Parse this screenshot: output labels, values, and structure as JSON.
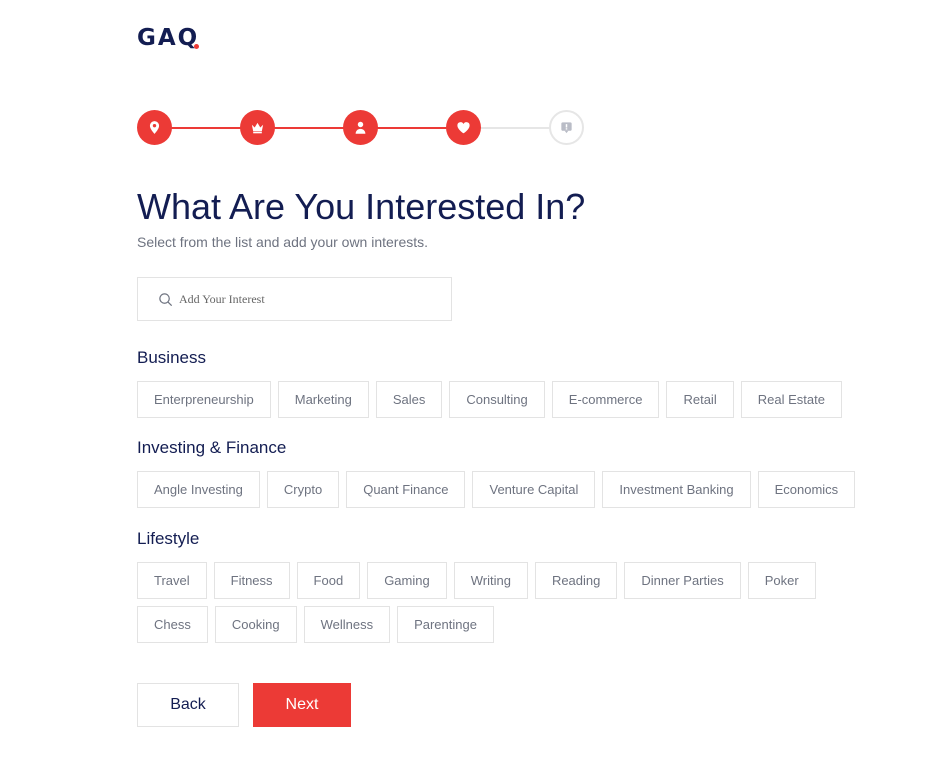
{
  "brand": {
    "logo_text": "GAQ"
  },
  "colors": {
    "accent": "#ec3a36",
    "navy": "#131d52",
    "muted": "#6e7380",
    "border": "#e3e3e3"
  },
  "stepper": {
    "steps": [
      {
        "icon": "location-pin-icon",
        "state": "done"
      },
      {
        "icon": "crown-icon",
        "state": "done"
      },
      {
        "icon": "user-icon",
        "state": "done"
      },
      {
        "icon": "heart-icon",
        "state": "done"
      },
      {
        "icon": "profile-card-icon",
        "state": "todo"
      }
    ]
  },
  "page": {
    "title": "What Are You Interested In?",
    "subtitle": "Select from the list and add your own interests."
  },
  "search": {
    "placeholder": "Add Your Interest",
    "value": ""
  },
  "categories": [
    {
      "title": "Business",
      "items": [
        "Enterpreneurship",
        "Marketing",
        "Sales",
        "Consulting",
        "E-commerce",
        "Retail",
        "Real Estate"
      ]
    },
    {
      "title": "Investing & Finance",
      "items": [
        "Angle Investing",
        "Crypto",
        "Quant Finance",
        "Venture Capital",
        "Investment Banking",
        "Economics"
      ]
    },
    {
      "title": "Lifestyle",
      "items": [
        "Travel",
        "Fitness",
        "Food",
        "Gaming",
        "Writing",
        "Reading",
        "Dinner Parties",
        "Poker",
        "Chess",
        "Cooking",
        "Wellness",
        "Parentinge"
      ]
    }
  ],
  "actions": {
    "back_label": "Back",
    "next_label": "Next"
  }
}
